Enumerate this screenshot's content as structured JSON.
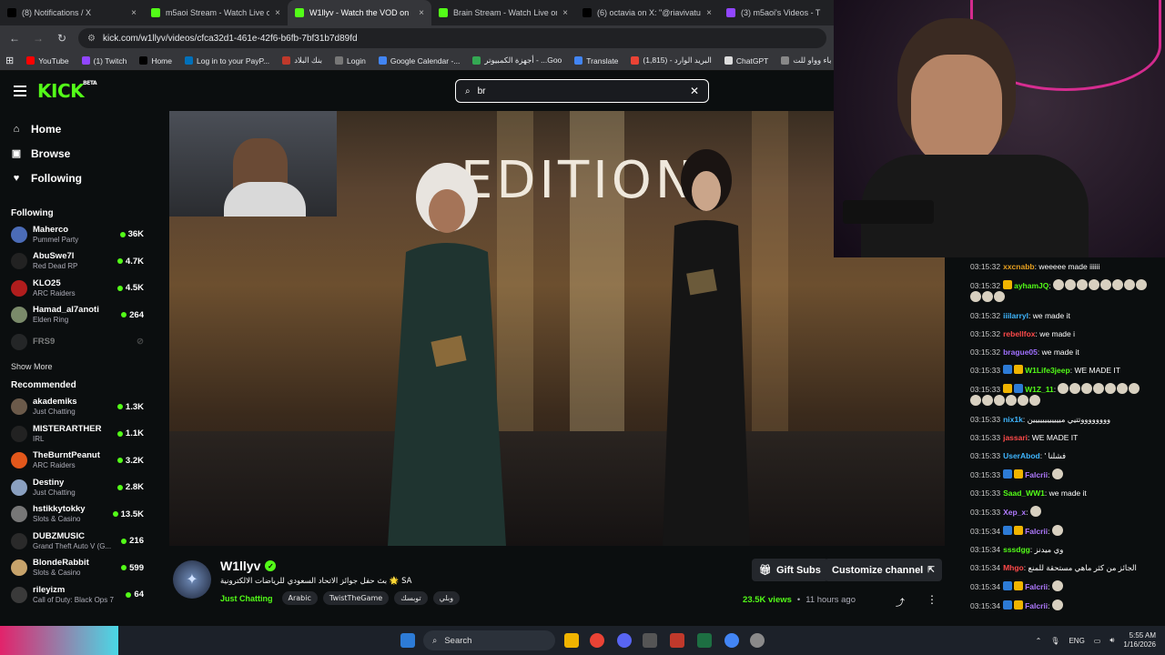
{
  "browser": {
    "tabs": [
      {
        "label": "(8) Notifications / X",
        "icon": "x-icon",
        "color": "#000000"
      },
      {
        "label": "m5aoi Stream - Watch Live on K",
        "icon": "kick-icon",
        "color": "#53fc18"
      },
      {
        "label": "W1llyv - Watch the VOD on",
        "icon": "kick-icon",
        "color": "#53fc18",
        "active": true
      },
      {
        "label": "Brain Stream - Watch Live on K",
        "icon": "kick-icon",
        "color": "#53fc18"
      },
      {
        "label": "(6) octavia on X: \"@riavivatu @",
        "icon": "x-icon",
        "color": "#000000"
      },
      {
        "label": "(3) m5aoi's Videos - T",
        "icon": "twitch-icon",
        "color": "#9146ff"
      }
    ],
    "url": "kick.com/w1llyv/videos/cfca32d1-461e-42f6-b6fb-7bf31b7d89fd",
    "bookmarks": [
      {
        "label": "YouTube",
        "color": "#ff0000"
      },
      {
        "label": "(1) Twitch",
        "color": "#9146ff"
      },
      {
        "label": "Home",
        "color": "#000000"
      },
      {
        "label": "Log in to your PayP...",
        "color": "#0070ba"
      },
      {
        "label": "بنك البلاد",
        "color": "#c0392b"
      },
      {
        "label": "Login",
        "color": "#777777"
      },
      {
        "label": "Google Calendar -...",
        "color": "#4285f4"
      },
      {
        "label": "أجهزة الكمبيوتر - ...Goo",
        "color": "#34a853"
      },
      {
        "label": "Translate",
        "color": "#4285f4"
      },
      {
        "label": "البريد الوارد - (1,815)",
        "color": "#ea4335"
      },
      {
        "label": "ChatGPT",
        "color": "#dddddd"
      },
      {
        "label": "مؤسسة باء وواو للت...",
        "color": "#888888"
      }
    ]
  },
  "header": {
    "logo": "KICK",
    "logo_badge": "BETA",
    "search_value": "br"
  },
  "sidebar": {
    "nav": [
      {
        "label": "Home",
        "icon": "home-icon",
        "glyph": "⌂"
      },
      {
        "label": "Browse",
        "icon": "browse-icon",
        "glyph": "▣"
      },
      {
        "label": "Following",
        "icon": "heart-icon",
        "glyph": "♥"
      }
    ],
    "following_title": "Following",
    "following": [
      {
        "name": "Maherco",
        "game": "Pummel Party",
        "viewers": "36K",
        "color": "#4b6cb7"
      },
      {
        "name": "AbuSwe7l",
        "game": "Red Dead RP",
        "viewers": "4.7K",
        "color": "#222222"
      },
      {
        "name": "KLO25",
        "game": "ARC Raiders",
        "viewers": "4.5K",
        "color": "#b11d1d"
      },
      {
        "name": "Hamad_al7anoti",
        "game": "Elden Ring",
        "viewers": "264",
        "color": "#7a8a6a"
      },
      {
        "name": "FRS9",
        "game": "",
        "viewers": "",
        "color": "#444444",
        "offline": true
      }
    ],
    "show_more": "Show More",
    "recommended_title": "Recommended",
    "recommended": [
      {
        "name": "akademiks",
        "game": "Just Chatting",
        "viewers": "1.3K",
        "color": "#6b5a4a"
      },
      {
        "name": "MISTERARTHER",
        "game": "IRL",
        "viewers": "1.1K",
        "color": "#222222"
      },
      {
        "name": "TheBurntPeanut",
        "game": "ARC Raiders",
        "viewers": "3.2K",
        "color": "#e2571b"
      },
      {
        "name": "Destiny",
        "game": "Just Chatting",
        "viewers": "2.8K",
        "color": "#8aa0c0"
      },
      {
        "name": "hstikkytokky",
        "game": "Slots & Casino",
        "viewers": "13.5K",
        "color": "#777777"
      },
      {
        "name": "DUBZMUSIC",
        "game": "Grand Theft Auto V (G...",
        "viewers": "216",
        "color": "#2a2a2a"
      },
      {
        "name": "BlondeRabbit",
        "game": "Slots & Casino",
        "viewers": "599",
        "color": "#c7a36b"
      },
      {
        "name": "rileyizm",
        "game": "Call of Duty: Black Ops 7",
        "viewers": "64",
        "color": "#3a3a3a"
      }
    ]
  },
  "video": {
    "overlay_text": "EDITION"
  },
  "chat": {
    "messages": [
      {
        "time": "03:15:32",
        "user": "xxcnabb",
        "color": "#e6a020",
        "text": "weeeee made iiiiii",
        "badges": []
      },
      {
        "time": "03:15:32",
        "user": "ayhamJQ",
        "color": "#53fc18",
        "text": "",
        "badges": [
          "#f0b400"
        ],
        "emotes": 11
      },
      {
        "time": "03:15:32",
        "user": "iiilarryl",
        "color": "#3fb6ff",
        "text": "we made it",
        "badges": []
      },
      {
        "time": "03:15:32",
        "user": "rebellfox",
        "color": "#ff4a4a",
        "text": "we made i",
        "badges": []
      },
      {
        "time": "03:15:32",
        "user": "brague05",
        "color": "#a070ff",
        "text": "we made it",
        "badges": []
      },
      {
        "time": "03:15:33",
        "user": "W1Life3jeep",
        "color": "#53fc18",
        "text": "WE MADE IT",
        "badges": [
          "#2d7bd6",
          "#f0b400"
        ]
      },
      {
        "time": "03:15:33",
        "user": "W1Z_11",
        "color": "#53fc18",
        "text": "",
        "badges": [
          "#f0b400",
          "#2d7bd6"
        ],
        "emotes": 13
      },
      {
        "time": "03:15:33",
        "user": "nix1k",
        "color": "#3fb6ff",
        "text": "ووووووووتتيي ميييييييييييين",
        "badges": []
      },
      {
        "time": "03:15:33",
        "user": "jassari",
        "color": "#ff4a4a",
        "text": "WE MADE IT",
        "badges": []
      },
      {
        "time": "03:15:33",
        "user": "UserAbod",
        "color": "#3fb6ff",
        "text": "' فشلنا",
        "badges": []
      },
      {
        "time": "03:15:33",
        "user": "Falcrii",
        "color": "#b07aff",
        "text": "",
        "badges": [
          "#2d7bd6",
          "#f0b400"
        ],
        "emotes": 1
      },
      {
        "time": "03:15:33",
        "user": "Saad_WW1",
        "color": "#53fc18",
        "text": "we made it",
        "badges": []
      },
      {
        "time": "03:15:33",
        "user": "Xep_x",
        "color": "#b07aff",
        "text": "",
        "badges": [],
        "emotes": 1
      },
      {
        "time": "03:15:34",
        "user": "Falcrii",
        "color": "#b07aff",
        "text": "",
        "badges": [
          "#2d7bd6",
          "#f0b400"
        ],
        "emotes": 1
      },
      {
        "time": "03:15:34",
        "user": "sssdgg",
        "color": "#53fc18",
        "text": "وي ميدنز",
        "badges": []
      },
      {
        "time": "03:15:34",
        "user": "Mhgo",
        "color": "#ff4a4a",
        "text": "الجائز من كثر ماهي مستحقة للمنع",
        "badges": []
      },
      {
        "time": "03:15:34",
        "user": "Falcrii",
        "color": "#b07aff",
        "text": "",
        "badges": [
          "#2d7bd6",
          "#f0b400"
        ],
        "emotes": 1
      },
      {
        "time": "03:15:34",
        "user": "Falcrii",
        "color": "#b07aff",
        "text": "",
        "badges": [
          "#2d7bd6",
          "#f0b400"
        ],
        "emotes": 1
      }
    ]
  },
  "channel": {
    "name": "W1llyv",
    "title": "بث حفل جوائز الاتحاد السعودي للرياضات الالكترونية 🌟 SA",
    "category": "Just Chatting",
    "tags": [
      "Arabic",
      "TwistTheGame",
      "توبسك",
      "وبلي"
    ],
    "gift_label": "Gift Subs",
    "customize_label": "Customize channel",
    "views": "23.5K views",
    "ago": "11 hours ago"
  },
  "taskbar": {
    "search_label": "Search",
    "lang": "ENG",
    "time": "5:55 AM",
    "date": "1/16/2026"
  }
}
